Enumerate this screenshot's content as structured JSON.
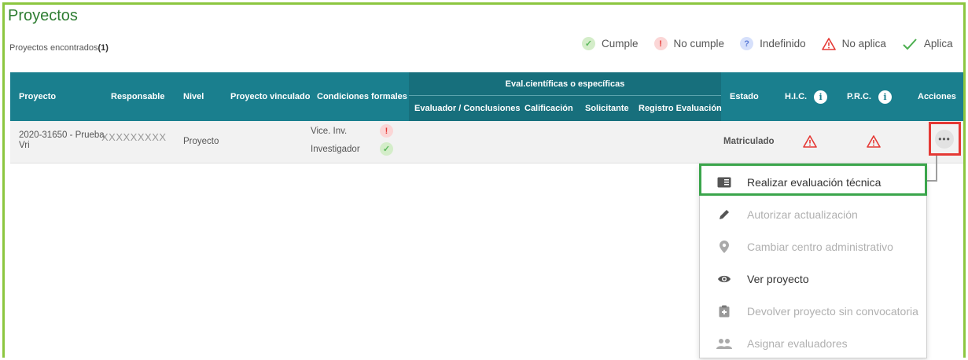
{
  "page": {
    "title": "Proyectos",
    "found_label": "Proyectos encontrados",
    "found_count": "(1)"
  },
  "legend": [
    {
      "label": "Cumple",
      "icon": "check-circle-green-icon"
    },
    {
      "label": "No cumple",
      "icon": "exclamation-circle-red-icon"
    },
    {
      "label": "Indefinido",
      "icon": "question-circle-blue-icon"
    },
    {
      "label": "No aplica",
      "icon": "warning-triangle-red-icon"
    },
    {
      "label": "Aplica",
      "icon": "checkmark-green-icon"
    }
  ],
  "table": {
    "headers": {
      "proyecto": "Proyecto",
      "responsable": "Responsable",
      "nivel": "Nivel",
      "vinculado": "Proyecto vinculado",
      "condiciones": "Condiciones formales",
      "eval_group": "Eval.científicas o específicas",
      "evaluador": "Evaluador / Conclusiones",
      "calificacion": "Calificación",
      "solicitante": "Solicitante",
      "registro": "Registro Evaluación",
      "estado": "Estado",
      "hic": "H.I.C.",
      "prc": "P.R.C.",
      "acciones": "Acciones"
    },
    "rows": [
      {
        "proyecto_line1": "2020-31650 - Prueba",
        "proyecto_line2": "Vri",
        "responsable": "XXXXXXXXX",
        "nivel": "Proyecto",
        "condicion1": "Vice. Inv.",
        "condicion2": "Investigador",
        "estado": "Matriculado",
        "actions_label": "•••"
      }
    ]
  },
  "menu": {
    "items": [
      {
        "label": "Realizar evaluación técnica",
        "icon": "book-icon",
        "enabled": true
      },
      {
        "label": "Autorizar actualización",
        "icon": "pencil-icon",
        "enabled": false
      },
      {
        "label": "Cambiar centro administrativo",
        "icon": "location-pin-icon",
        "enabled": false
      },
      {
        "label": "Ver proyecto",
        "icon": "eye-icon",
        "enabled": true
      },
      {
        "label": "Devolver proyecto sin convocatoria",
        "icon": "clipboard-icon",
        "enabled": false
      },
      {
        "label": "Asignar evaluadores",
        "icon": "users-icon",
        "enabled": false
      }
    ]
  },
  "colors": {
    "header_bg": "#1a7f8e",
    "title_green": "#2e7d32",
    "frame_green": "#8cc63f",
    "highlight_red": "#e53935",
    "highlight_green": "#3aa54b"
  }
}
